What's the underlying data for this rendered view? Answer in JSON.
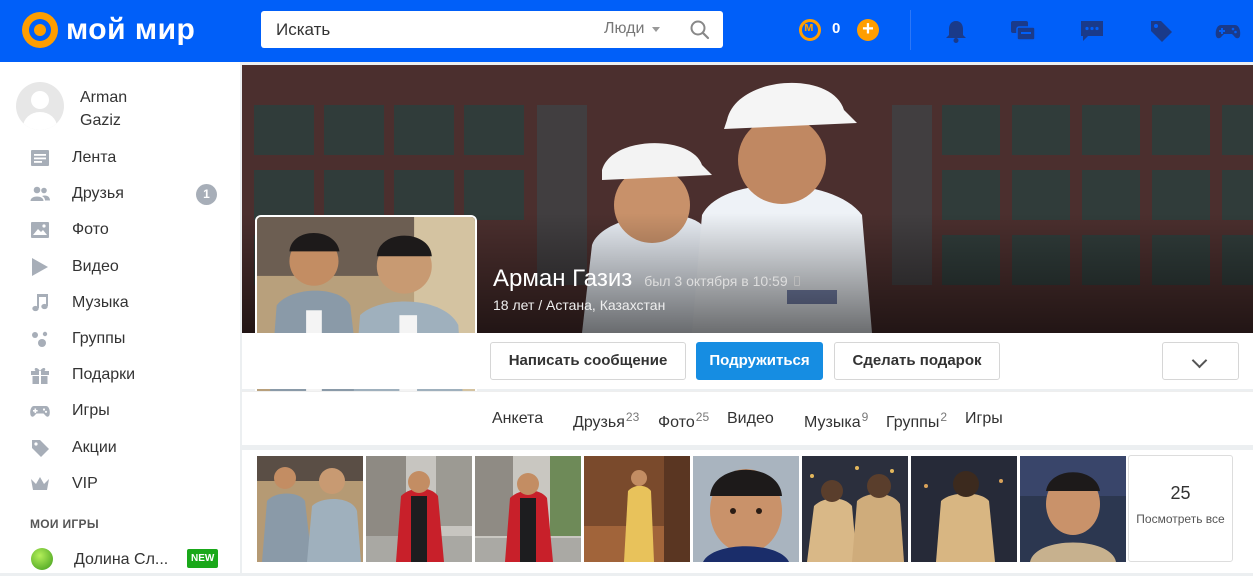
{
  "header": {
    "logo_text": "мой мир",
    "search_placeholder": "Искать",
    "search_scope": "Люди",
    "coins": "0",
    "plus": "+"
  },
  "sidebar": {
    "user_first": "Arman",
    "user_last": "Gaziz",
    "items": [
      {
        "label": "Лента",
        "icon": "feed-icon"
      },
      {
        "label": "Друзья",
        "icon": "friends-icon",
        "badge": "1"
      },
      {
        "label": "Фото",
        "icon": "photo-icon"
      },
      {
        "label": "Видео",
        "icon": "video-icon"
      },
      {
        "label": "Музыка",
        "icon": "music-icon"
      },
      {
        "label": "Группы",
        "icon": "groups-icon"
      },
      {
        "label": "Подарки",
        "icon": "gift-icon"
      },
      {
        "label": "Игры",
        "icon": "gamepad-icon"
      },
      {
        "label": "Акции",
        "icon": "tag-icon"
      },
      {
        "label": "VIP",
        "icon": "crown-icon"
      }
    ],
    "games_title": "МОИ ИГРЫ",
    "game": {
      "label": "Долина Сл...",
      "badge": "NEW"
    }
  },
  "profile": {
    "name": "Арман Газиз",
    "last_seen": "был 3 октября в 10:59",
    "meta": "18 лет / Астана, Казахстан"
  },
  "actions": {
    "message": "Написать сообщение",
    "befriend": "Подружиться",
    "gift": "Сделать подарок"
  },
  "tabs": [
    {
      "label": "Анкета",
      "count": ""
    },
    {
      "label": "Друзья",
      "count": "23"
    },
    {
      "label": "Фото",
      "count": "25"
    },
    {
      "label": "Видео",
      "count": ""
    },
    {
      "label": "Музыка",
      "count": "9"
    },
    {
      "label": "Группы",
      "count": "2"
    },
    {
      "label": "Игры",
      "count": ""
    }
  ],
  "photos": {
    "total": "25",
    "see_all": "Посмотреть все"
  },
  "colors": {
    "header_bg": "#005ff9",
    "accent": "#ff9e00",
    "primary_button": "#168de2",
    "new_badge": "#1aa81a"
  }
}
